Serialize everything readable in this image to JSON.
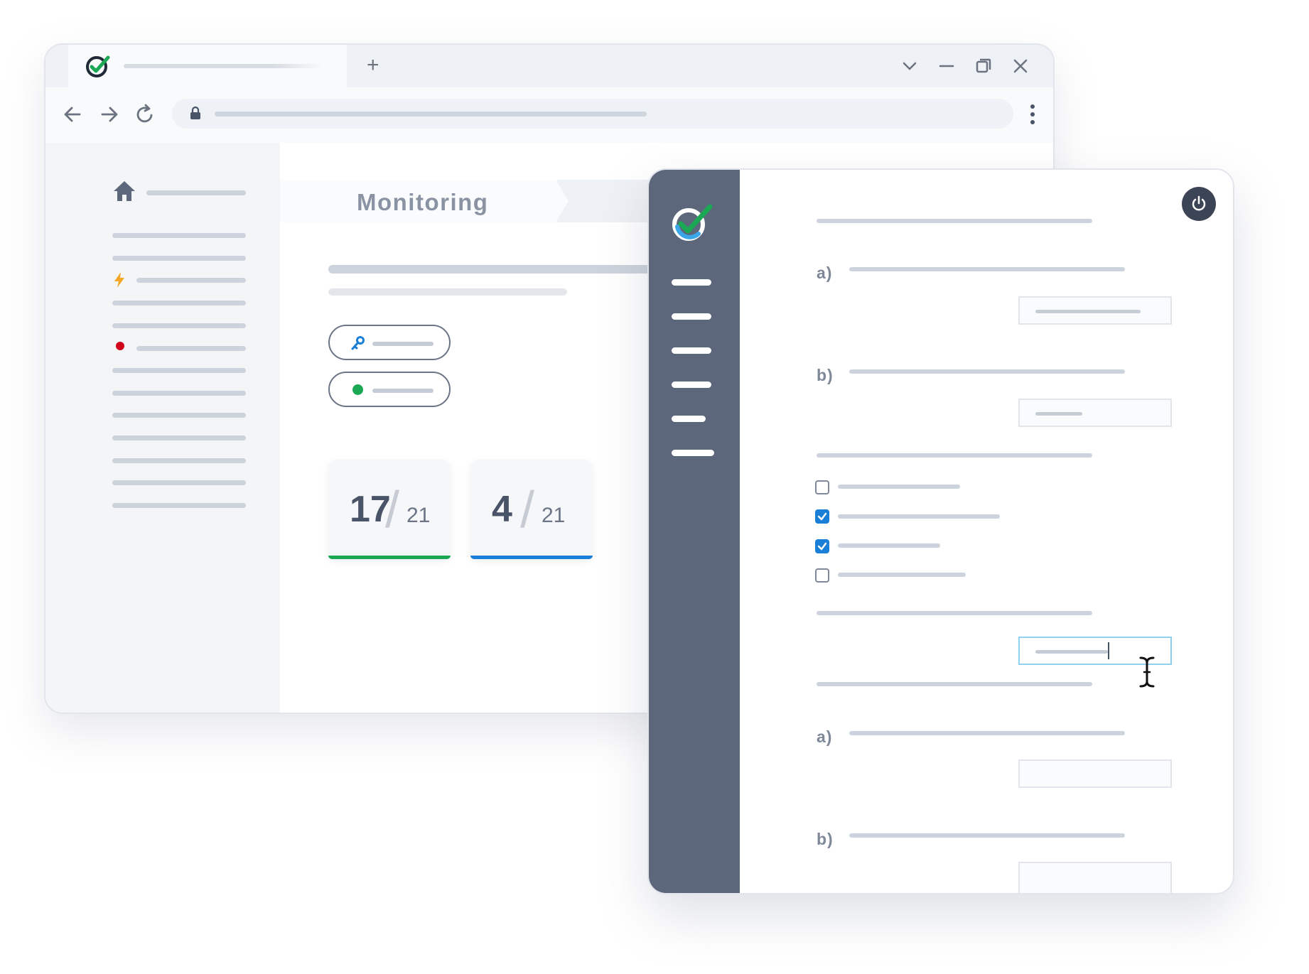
{
  "browser": {
    "new_tab": "+",
    "page_title": "Monitoring",
    "sidebar_indicators": {
      "bolt_color": "#f5a623",
      "dot_color": "#d0021b"
    },
    "pills": [
      {
        "icon": "key-icon",
        "color": "#1a7fd6"
      },
      {
        "icon": "status-dot-icon",
        "color": "#1ba855"
      }
    ],
    "stats": [
      {
        "value": "17",
        "total": "21",
        "accent": "#1ba855"
      },
      {
        "value": "4",
        "total": "21",
        "accent": "#1a7fd6"
      }
    ]
  },
  "form": {
    "labels": {
      "a1": "a)",
      "b1": "b)",
      "a2": "a)",
      "b2": "b)"
    },
    "checkboxes": [
      {
        "checked": false
      },
      {
        "checked": true
      },
      {
        "checked": true
      },
      {
        "checked": false
      }
    ]
  },
  "colors": {
    "sidebar": "#5c677b",
    "accent_blue": "#1a7fd6",
    "accent_green": "#1ba855",
    "focus": "#8fd1ef"
  }
}
